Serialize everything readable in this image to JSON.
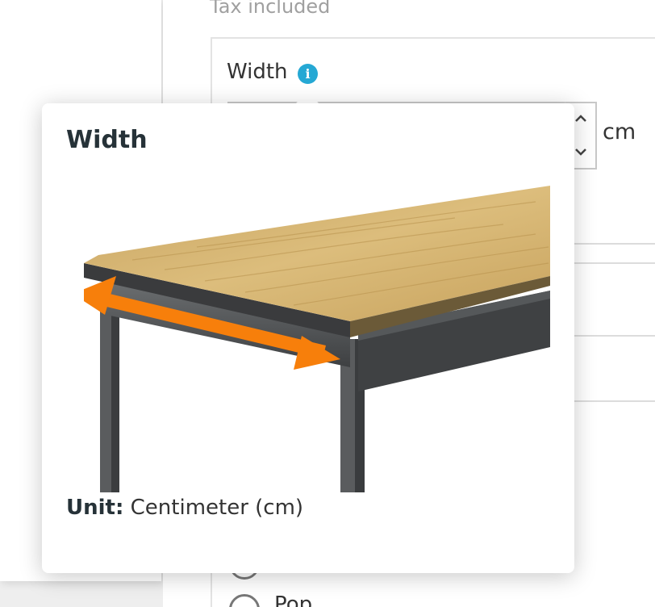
{
  "price": {
    "tax_note": "Tax included"
  },
  "field": {
    "label": "Width",
    "info_icon": "info-icon",
    "input_value": "",
    "unit": "cm",
    "spin_up_icon": "chevron-up-icon",
    "spin_down_icon": "chevron-down-icon"
  },
  "options": {
    "items": [
      {
        "label": "Pop",
        "selected": false
      }
    ]
  },
  "tooltip": {
    "title": "Width",
    "unit_label": "Unit:",
    "unit_value": "Centimeter (cm)",
    "image_icon": "table-width-illustration",
    "colors": {
      "arrow": "#f77f0b",
      "table_top": "#d7b672",
      "frame": "#4d4f51",
      "info": "#25a8d4"
    }
  }
}
